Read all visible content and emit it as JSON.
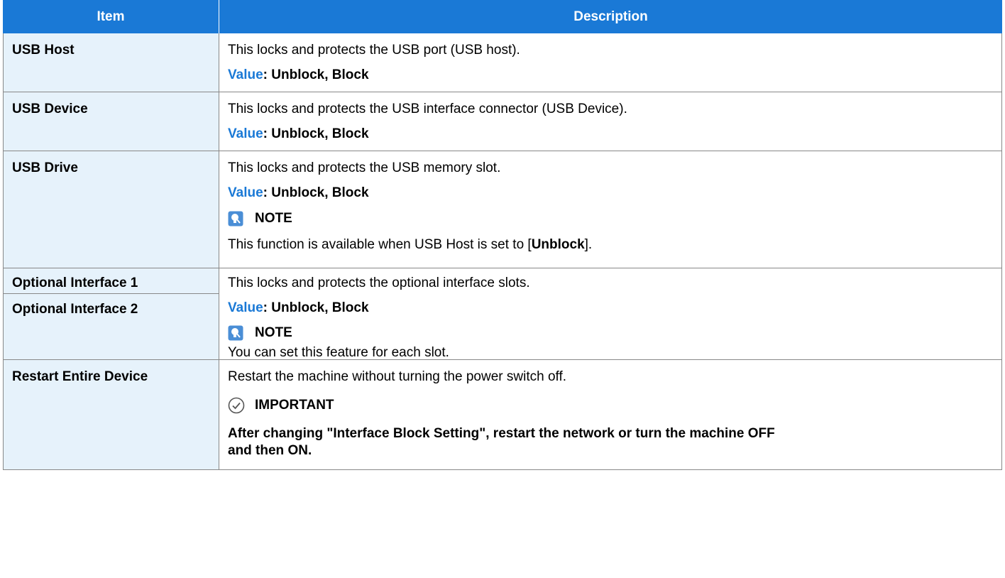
{
  "header": {
    "item": "Item",
    "description": "Description"
  },
  "rows": [
    {
      "item": "USB Host",
      "desc": "This locks and protects the USB port (USB host).",
      "value_key": "Value",
      "value_rest": ": Unblock, Block"
    },
    {
      "item": "USB Device",
      "desc": "This locks and protects the USB interface connector (USB Device).",
      "value_key": "Value",
      "value_rest": ": Unblock, Block"
    },
    {
      "item": "USB Drive",
      "desc": "This locks and protects the USB memory slot.",
      "value_key": "Value",
      "value_rest": ": Unblock, Block",
      "note_label": "NOTE",
      "note_pre": "This function is available when USB Host is set to [",
      "note_bold": "Unblock",
      "note_post": "]."
    },
    {
      "item1": "Optional Interface 1",
      "item2": "Optional Interface 2",
      "desc": "This locks and protects the optional interface slots.",
      "value_key": "Value",
      "value_rest": ": Unblock, Block",
      "note_label": "NOTE",
      "note_text": "You can set this feature for each slot."
    },
    {
      "item": "Restart Entire Device",
      "desc": "Restart the machine without turning the power switch off.",
      "important_label": "IMPORTANT",
      "important_text1": "After changing \"Interface Block Setting\", restart the network or turn the machine OFF",
      "important_text2": "and then ON."
    }
  ],
  "colors": {
    "header_bg": "#1a79d6",
    "item_bg": "#e6f2fb",
    "value_key": "#1a79d6"
  },
  "icons": {
    "note": "lightbulb-note-icon",
    "important": "checkmark-circle-icon"
  }
}
